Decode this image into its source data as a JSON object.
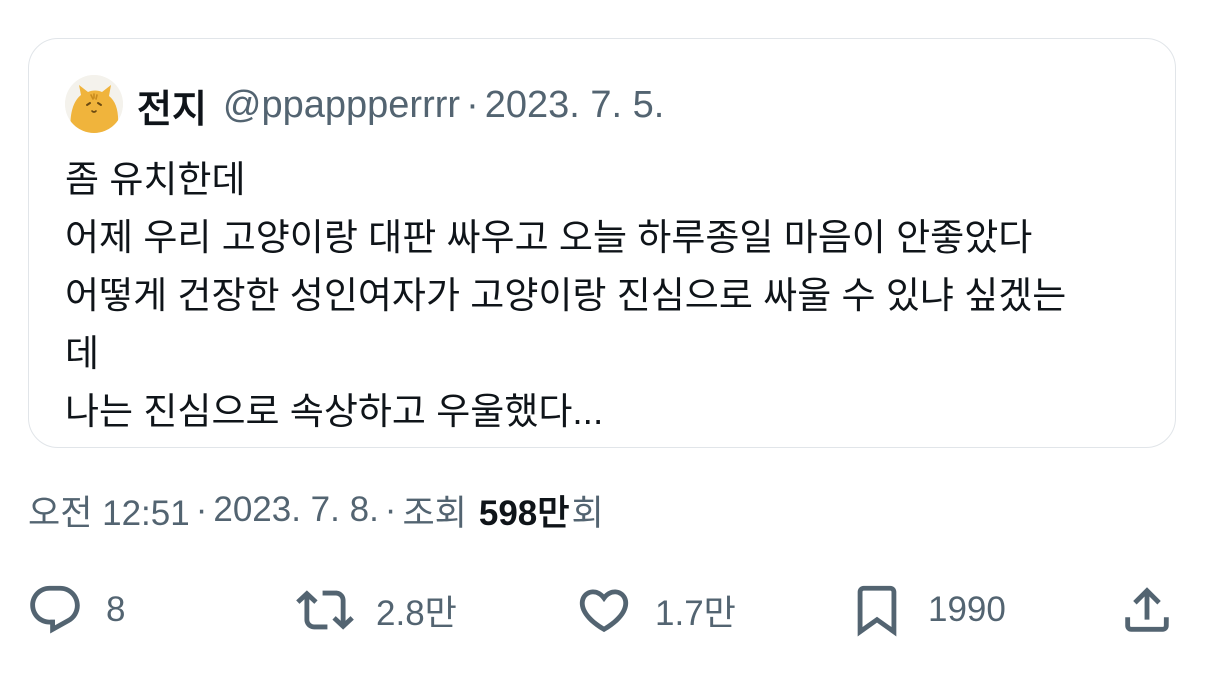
{
  "quoted_tweet": {
    "author_name": "전지",
    "author_handle": "@ppappperrrr",
    "separator": "·",
    "date": "2023. 7. 5.",
    "text_lines": [
      "좀 유치한데",
      "어제 우리 고양이랑 대판 싸우고 오늘 하루종일 마음이 안좋았다",
      "어떻게 건장한 성인여자가 고양이랑 진심으로 싸울 수 있냐 싶겠는",
      "데",
      "나는 진심으로 속상하고 우울했다..."
    ]
  },
  "meta": {
    "time": "오전 12:51",
    "separator": "·",
    "date": "2023. 7. 8.",
    "views_label": "조회",
    "views_count": "598만",
    "views_suffix": "회"
  },
  "actions": {
    "reply_count": "8",
    "retweet_count": "2.8만",
    "like_count": "1.7만",
    "bookmark_count": "1990"
  },
  "colors": {
    "text_primary": "#0f1419",
    "text_secondary": "#536471",
    "border": "#e1e5e9",
    "avatar_cat": "#f0b43c"
  },
  "icons": {
    "reply": "speech-bubble-icon",
    "retweet": "retweet-arrows-icon",
    "like": "heart-icon",
    "bookmark": "bookmark-icon",
    "share": "share-upload-icon",
    "avatar": "cat-avatar-icon"
  }
}
